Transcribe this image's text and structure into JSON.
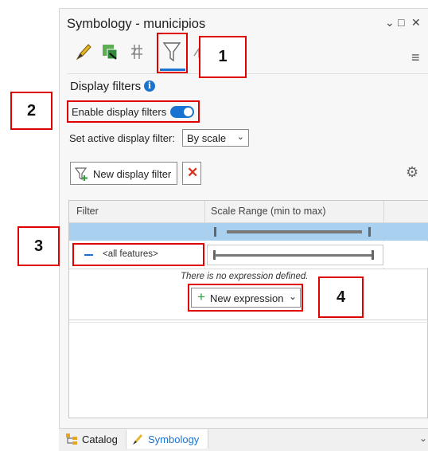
{
  "window": {
    "title": "Symbology - municipios",
    "controls": [
      "⌄",
      "□",
      "✕"
    ]
  },
  "tabs": [
    {
      "icon": "paintbrush-icon"
    },
    {
      "icon": "vary-symbology-icon"
    },
    {
      "icon": "label-hatch-icon"
    },
    {
      "icon": "funnel-filter-icon",
      "selected": true
    },
    {
      "icon": "properties-edit-icon"
    }
  ],
  "section": {
    "title": "Display filters",
    "info_icon": "i"
  },
  "enable_filters": {
    "label": "Enable display filters",
    "on": true
  },
  "active_filter": {
    "label": "Set active display filter:",
    "value": "By scale"
  },
  "toolbar": {
    "new_filter_label": "New display filter"
  },
  "table": {
    "columns": [
      "Filter",
      "Scale Range (min to max)"
    ],
    "rows": [
      {
        "filter": "",
        "selected": true
      },
      {
        "filter": "<all features>",
        "selected": false
      }
    ],
    "no_expression_text": "There is no expression defined.",
    "new_expression_label": "New expression"
  },
  "callouts": [
    "1",
    "2",
    "3",
    "4"
  ],
  "bottom_tabs": [
    "Catalog",
    "Symbology"
  ],
  "colors": {
    "accent": "#1b73d1",
    "callout": "#e00000",
    "selected_row": "#a9d0ee"
  }
}
